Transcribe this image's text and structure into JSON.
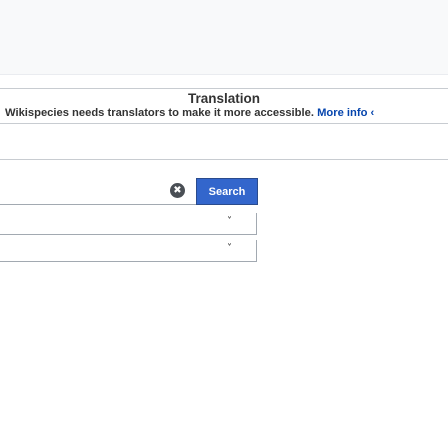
{
  "banner": {
    "title": "Translation",
    "text": "Wikispecies needs translators to make it more accessible.",
    "link": "More info ‹"
  },
  "search": {
    "value": "",
    "placeholder": "",
    "clear_icon": "✖",
    "button_label": "Search"
  },
  "selects": [
    {
      "value": "",
      "chevron": "˅"
    },
    {
      "value": "",
      "chevron": "˅"
    }
  ],
  "colors": {
    "button_bg": "#3366cc",
    "link": "#0645ad",
    "border": "#a2a9b1"
  }
}
